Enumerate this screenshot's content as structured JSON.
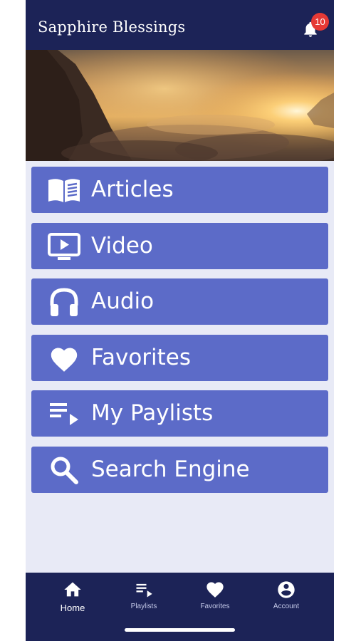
{
  "header": {
    "title": "Sapphire Blessings",
    "notification_count": "10"
  },
  "menu": [
    {
      "label": "Articles",
      "icon": "book-icon"
    },
    {
      "label": "Video",
      "icon": "video-icon"
    },
    {
      "label": "Audio",
      "icon": "headphones-icon"
    },
    {
      "label": "Favorites",
      "icon": "heart-icon"
    },
    {
      "label": "My Paylists",
      "icon": "playlist-icon"
    },
    {
      "label": "Search Engine",
      "icon": "search-icon"
    }
  ],
  "bottom_nav": [
    {
      "label": "Home",
      "icon": "home-icon",
      "active": true
    },
    {
      "label": "Playlists",
      "icon": "playlist-icon",
      "active": false
    },
    {
      "label": "Favorites",
      "icon": "heart-icon",
      "active": false
    },
    {
      "label": "Account",
      "icon": "account-icon",
      "active": false
    }
  ],
  "colors": {
    "header_bg": "#1c2357",
    "menu_button_bg": "#5c6bc8",
    "page_bg": "#e8eaf6",
    "badge": "#e53935"
  }
}
